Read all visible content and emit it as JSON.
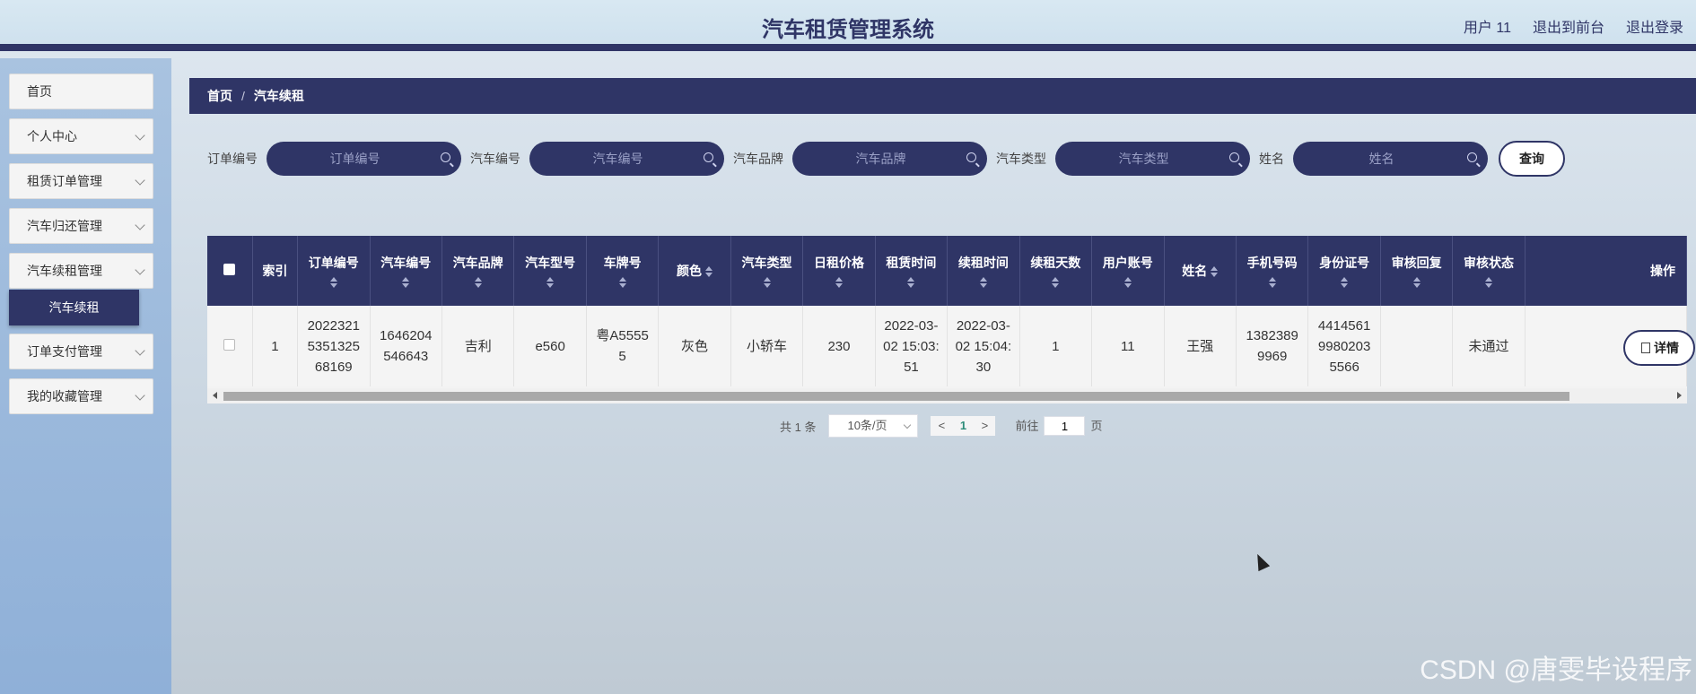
{
  "header": {
    "title": "汽车租赁管理系统",
    "user": "用户 11",
    "back_front": "退出到前台",
    "logout": "退出登录"
  },
  "sidebar": {
    "items": [
      {
        "label": "首页"
      },
      {
        "label": "个人中心"
      },
      {
        "label": "租赁订单管理"
      },
      {
        "label": "汽车归还管理"
      },
      {
        "label": "汽车续租管理"
      },
      {
        "label": "订单支付管理"
      },
      {
        "label": "我的收藏管理"
      }
    ],
    "active_sub": "汽车续租"
  },
  "breadcrumb": {
    "home": "首页",
    "sep": "/",
    "current": "汽车续租"
  },
  "search": {
    "fields": [
      {
        "label": "订单编号",
        "placeholder": "订单编号"
      },
      {
        "label": "汽车编号",
        "placeholder": "汽车编号"
      },
      {
        "label": "汽车品牌",
        "placeholder": "汽车品牌"
      },
      {
        "label": "汽车类型",
        "placeholder": "汽车类型"
      },
      {
        "label": "姓名",
        "placeholder": "姓名"
      }
    ],
    "button": "查询"
  },
  "table": {
    "headers": [
      "索引",
      "订单编号",
      "汽车编号",
      "汽车品牌",
      "汽车型号",
      "车牌号",
      "颜色",
      "汽车类型",
      "日租价格",
      "租赁时间",
      "续租时间",
      "续租天数",
      "用户账号",
      "姓名",
      "手机号码",
      "身份证号",
      "审核回复",
      "审核状态",
      "操作"
    ],
    "rows": [
      [
        "1",
        "20223215351325 68169",
        "1646204546643",
        "吉利",
        "e560",
        "粤A55555",
        "灰色",
        "小轿车",
        "230",
        "2022-03-02 15:03:51",
        "2022-03-02 15:04:30",
        "1",
        "11",
        "王强",
        "13823899969",
        "441456199802035566",
        "",
        "未通过"
      ]
    ],
    "detail_button": "详情"
  },
  "pagination": {
    "total": "共 1 条",
    "page_size": "10条/页",
    "prev": "<",
    "current": "1",
    "next": ">",
    "goto": "前往",
    "goto_value": "1",
    "page_unit": "页"
  },
  "watermark": "CSDN @唐雯毕设程序"
}
